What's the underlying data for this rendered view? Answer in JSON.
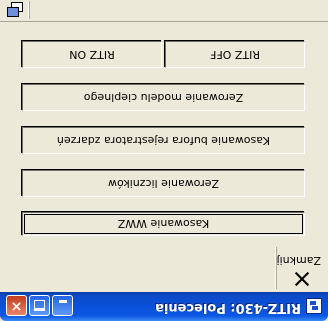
{
  "window": {
    "title": "RITZ-430: Polecenia",
    "minimize_label": "_",
    "maximize_label": "□",
    "close_label": "×"
  },
  "command_bar": {
    "close_label": "Zamknij"
  },
  "buttons": {
    "ritz_on": "RITZ ON",
    "ritz_off": "RITZ OFF",
    "zero_heat_model": "Zerowanie modelu cieplnego",
    "clear_event_buffer": "Kasowanie bufora rejestratora zdarzeń",
    "zero_counters": "Zerowanie liczników",
    "clear_wwz": "Kasowanie WWZ"
  },
  "icons": {
    "app": "app-window-icon",
    "close_cmd": "close-x-icon",
    "toolbar": "window-list-icon"
  },
  "colors": {
    "titlebar": "#0b57e3",
    "face": "#ece9d8",
    "close_button": "#c43b1d"
  }
}
